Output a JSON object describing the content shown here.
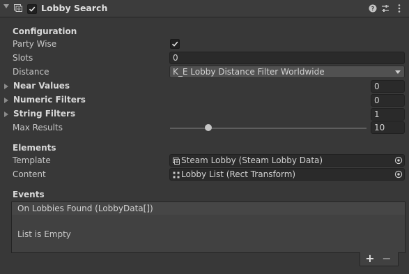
{
  "header": {
    "title": "Lobby Search",
    "enabled": true
  },
  "configuration": {
    "section_label": "Configuration",
    "party_wise_label": "Party Wise",
    "party_wise_checked": true,
    "slots_label": "Slots",
    "slots_value": "0",
    "distance_label": "Distance",
    "distance_value": "K_E Lobby Distance Filter Worldwide",
    "near_values_label": "Near Values",
    "near_values_count": "0",
    "numeric_filters_label": "Numeric Filters",
    "numeric_filters_count": "0",
    "string_filters_label": "String Filters",
    "string_filters_count": "1",
    "max_results_label": "Max Results",
    "max_results_value": "10"
  },
  "elements": {
    "section_label": "Elements",
    "template_label": "Template",
    "template_value": "Steam Lobby (Steam Lobby Data)",
    "content_label": "Content",
    "content_value": "Lobby List (Rect Transform)"
  },
  "events": {
    "section_label": "Events",
    "event_title": "On Lobbies Found (LobbyData[])",
    "empty_text": "List is Empty",
    "add_label": "+",
    "remove_label": "−"
  },
  "colors": {
    "background": "#383838",
    "field": "#2a2a2a",
    "text": "#d2d2d2"
  }
}
